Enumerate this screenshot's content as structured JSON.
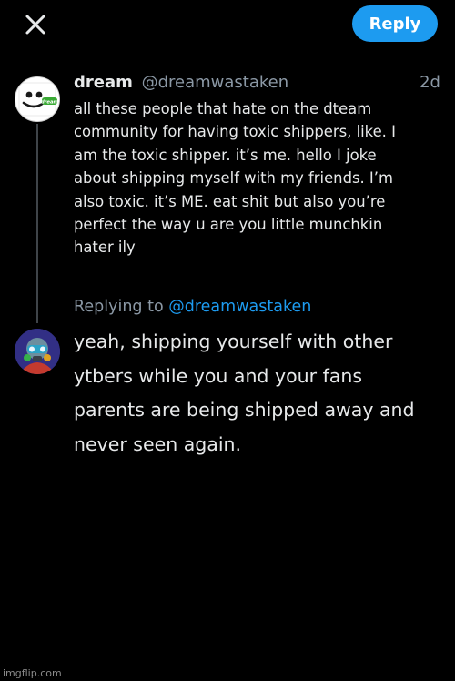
{
  "colors": {
    "background": "#000000",
    "accent": "#1d9bf0",
    "text_primary": "#e7e9ea",
    "text_secondary": "#8b98a5"
  },
  "header": {
    "close_icon": "close-icon",
    "reply_label": "Reply"
  },
  "original_tweet": {
    "display_name": "dream",
    "handle": "@dreamwastaken",
    "timestamp": "2d",
    "avatar_text": "dream",
    "text_lines": [
      "all these people that hate on the dteam",
      "community for having toxic shippers, like. I",
      "am the toxic shipper. it’s me. hello I joke",
      "about shipping myself with my friends. I’m",
      "also toxic. it’s ME. eat shit but also you’re",
      "perfect the way u are you little munchkin",
      "hater ily"
    ]
  },
  "compose": {
    "replying_to_label": "Replying to",
    "replying_to_handle": "@dreamwastaken",
    "text_lines": [
      "yeah, shipping yourself with other",
      "ytbers while you and your fans",
      "parents are being shipped away and",
      "never seen again."
    ]
  },
  "watermark": "imgflip.com"
}
